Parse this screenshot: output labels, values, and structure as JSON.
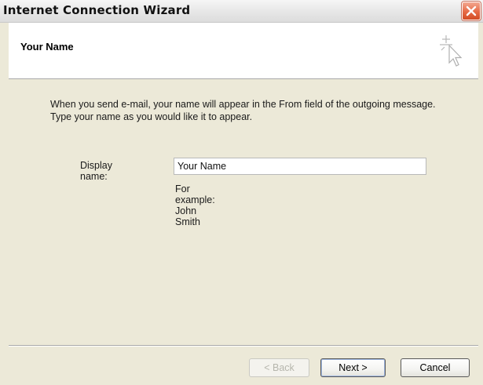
{
  "window": {
    "title": "Internet Connection Wizard"
  },
  "header": {
    "title": "Your Name",
    "icon": "wizard-cursor-sparkle-icon"
  },
  "main": {
    "instructions_line1": "When you send e-mail, your name will appear in the From field of the outgoing message.",
    "instructions_line2": "Type your name as you would like it to appear.",
    "display_name_label": "Display name:",
    "display_name_value": "Your Name",
    "example_text": "For example: John Smith"
  },
  "buttons": {
    "back": "< Back",
    "next": "Next >",
    "cancel": "Cancel"
  },
  "colors": {
    "dialog_bg": "#ece9d8",
    "close_button": "#e66a45"
  }
}
